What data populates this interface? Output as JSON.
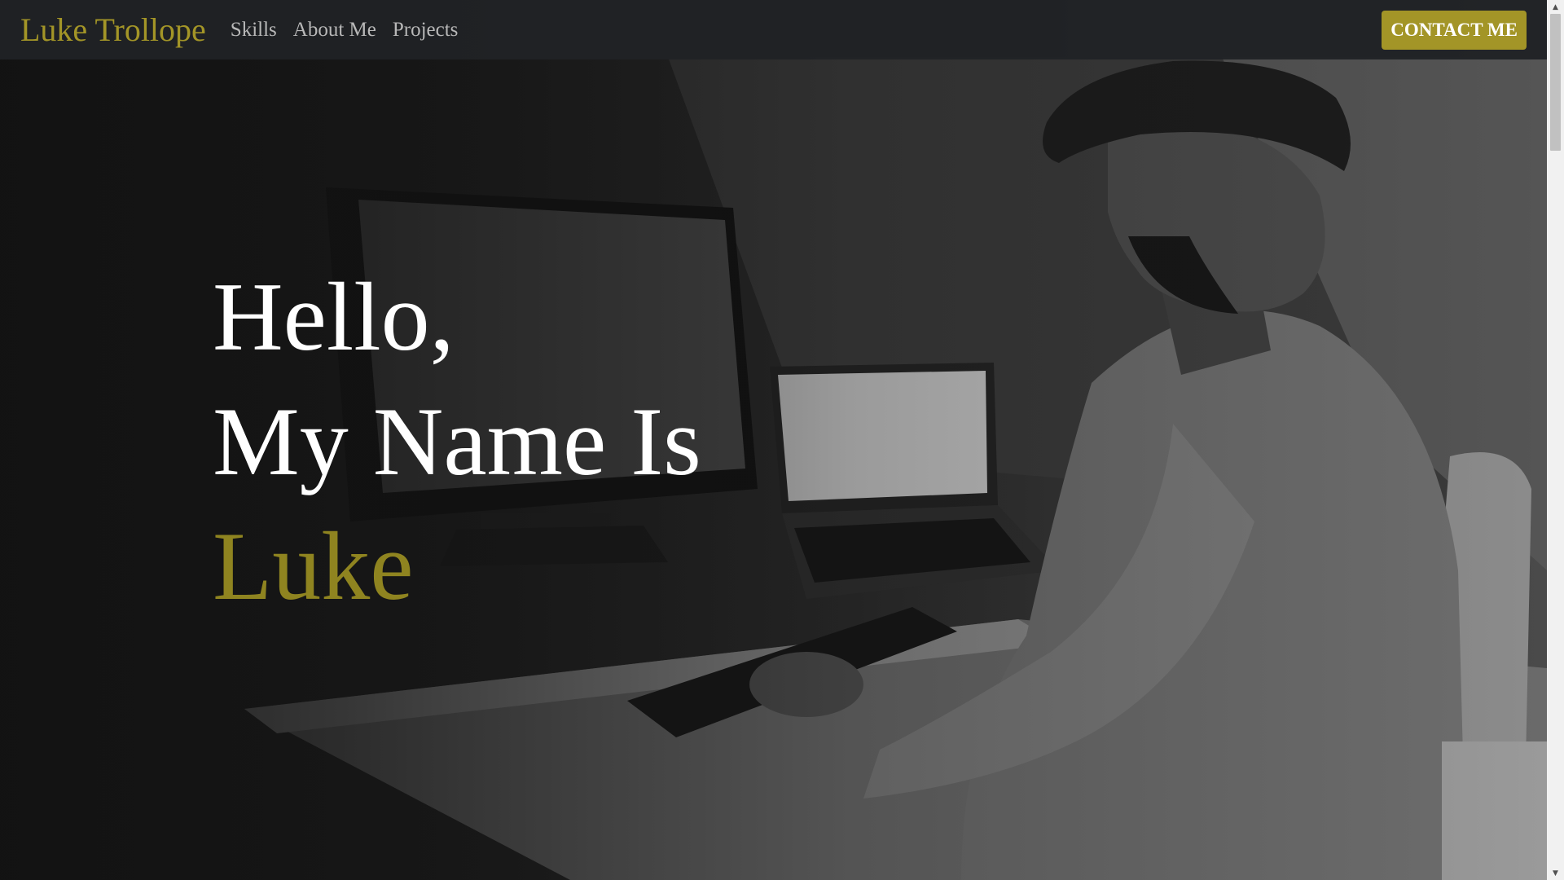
{
  "navbar": {
    "brand": "Luke Trollope",
    "links": [
      {
        "label": "Skills"
      },
      {
        "label": "About Me"
      },
      {
        "label": "Projects"
      }
    ],
    "contact_label": "CONTACT ME"
  },
  "hero": {
    "line1": "Hello,",
    "line2": "My Name Is",
    "name": "Luke",
    "image_description": "grayscale-photo-man-at-desk-with-monitor-laptop-keyboard"
  },
  "colors": {
    "accent": "#a39527",
    "navbar_bg": "#202225",
    "text_white": "#ffffff",
    "nav_link": "#b8b8b8"
  },
  "icons": {
    "scroll_up": "scroll-up-arrow-icon",
    "scroll_down": "scroll-down-arrow-icon"
  }
}
